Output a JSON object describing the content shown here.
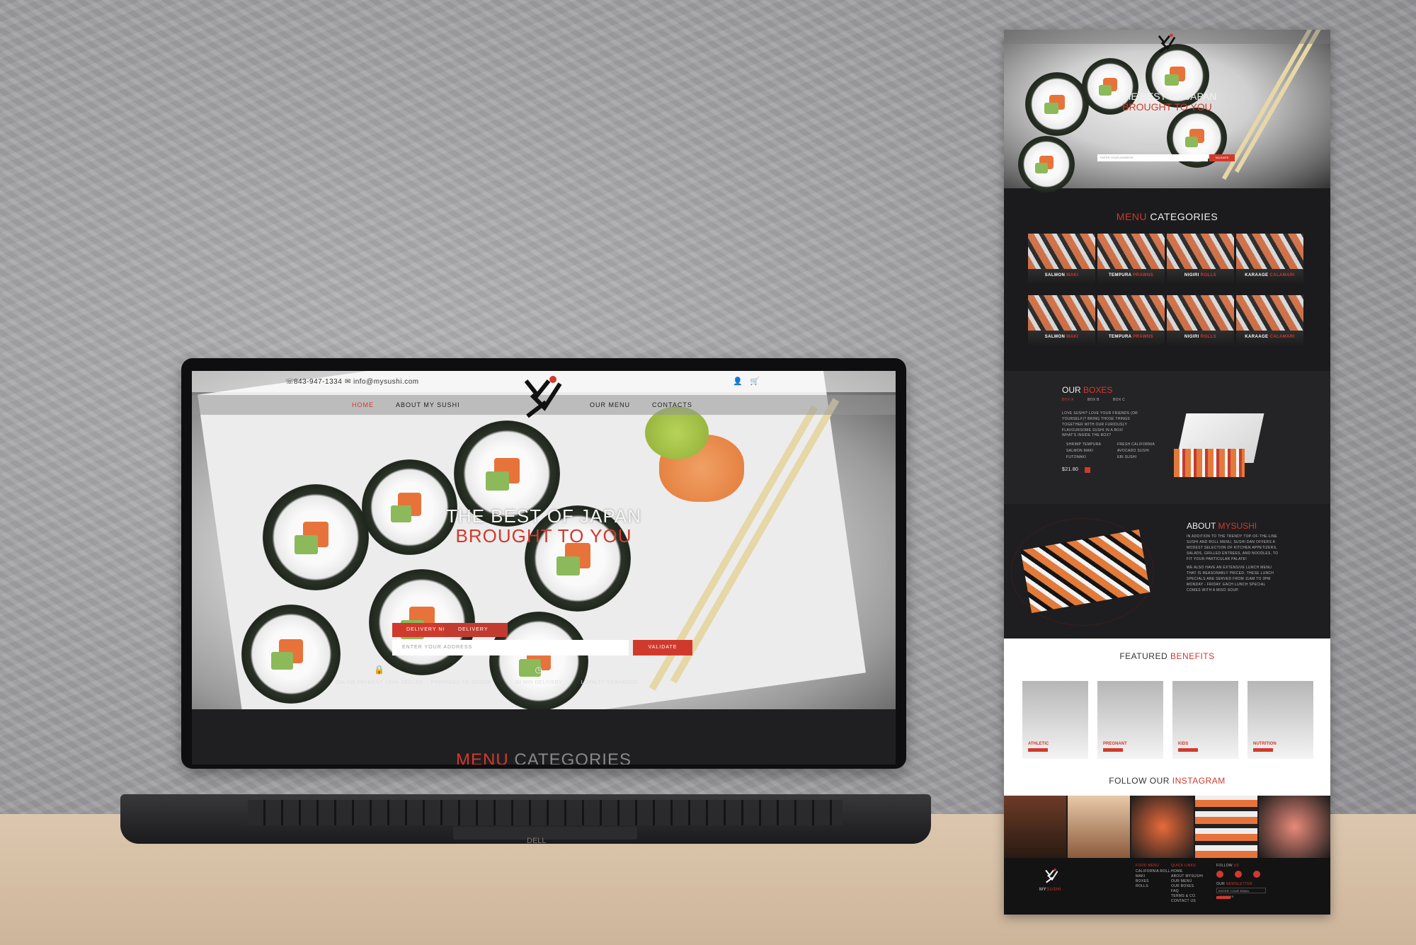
{
  "laptop": {
    "topbar": {
      "phone": "843-947-1334",
      "email": "info@mysushi.com"
    },
    "nav": [
      "HOME",
      "ABOUT MY SUSHI",
      "OUR MENU",
      "CONTACTS"
    ],
    "hero": {
      "line1": "THE BEST OF JAPAN",
      "line2": "BROUGHT TO YOU"
    },
    "delivery_tabs": [
      "DELIVERY NOW",
      "DELIVERY LATER"
    ],
    "address_placeholder": "ENTER YOUR ADDRESS",
    "validate_label": "VALIDATE",
    "features": [
      {
        "icon": "lock-icon",
        "label": "ONLINE PAYMENT 100% SECURE"
      },
      {
        "icon": "timer-icon",
        "label": "PREPARED TO ORDER"
      },
      {
        "icon": "clock-icon",
        "label": "30 MIN DELIVERY"
      },
      {
        "icon": "heart-icon",
        "label": "LOYALTY REWARDED"
      }
    ],
    "section_title": {
      "accent": "MENU",
      "rest": "CATEGORIES"
    },
    "brand": "DELL"
  },
  "tall": {
    "hero": {
      "line1": "THE BEST OF JAPAN",
      "line2": "BROUGHT TO YOU",
      "validate_label": "VALIDATE",
      "address_placeholder": "ENTER YOUR ADDRESS"
    },
    "menu_title": {
      "accent": "MENU",
      "rest": "CATEGORIES"
    },
    "categories": [
      {
        "name": "SALMON",
        "accent": "MAKI"
      },
      {
        "name": "TEMPURA",
        "accent": "PRAWNS"
      },
      {
        "name": "NIGIRI",
        "accent": "ROLLS"
      },
      {
        "name": "KARAAGE",
        "accent": "CALAMARI"
      },
      {
        "name": "SALMON",
        "accent": "MAKI"
      },
      {
        "name": "TEMPURA",
        "accent": "PRAWNS"
      },
      {
        "name": "NIGIRI",
        "accent": "ROLLS"
      },
      {
        "name": "KARAAGE",
        "accent": "CALAMARI"
      }
    ],
    "boxes": {
      "title": "OUR",
      "title_accent": "BOXES",
      "tabs": [
        "BOX A",
        "BOX B",
        "BOX C"
      ],
      "intro": "LOVE SUSHI? LOVE YOUR FRIENDS (OR YOURSELF)? BRING THOSE THINGS TOGETHER WITH OUR FURIOUSLY FLAVOURSOME SUSHI IN A BOX!",
      "inside_title": "WHAT'S INSIDE THE BOX?",
      "items_left": [
        "SHRIMP TEMPURA",
        "SALMON MAKI",
        "FUTOMAKI"
      ],
      "items_right": [
        "FRESH CALIFORNIA",
        "AVOCADO SUSHI",
        "EBI SUSHI"
      ],
      "price": "$21.80"
    },
    "about": {
      "title": "ABOUT",
      "title_accent": "MYSUSHI",
      "p1": "IN ADDITION TO THE TRENDY TOP-OF-THE-LINE SUSHI AND ROLL MENU, SUSHI DAN OFFERS A MODEST SELECTION OF KITCHEN APPETIZERS, SALADS, GRILLED ENTREES, AND NOODLES, TO FIT YOUR PARTICULAR PALATE!",
      "p2": "WE ALSO HAVE AN EXTENSIVE LUNCH MENU THAT IS REASONABLY PRICED. THESE LUNCH SPECIALS ARE SERVED FROM 11AM TO 3PM MONDAY - FRIDAY. EACH LUNCH SPECIAL COMES WITH A MISO SOUP."
    },
    "benefits_title": {
      "rest": "FEATURED",
      "accent": "BENEFITS"
    },
    "benefits": [
      "ATHLETIC",
      "PREGNANT",
      "KIDS",
      "NUTRITION"
    ],
    "instagram_title": {
      "rest": "FOLLOW OUR",
      "accent": "INSTAGRAM"
    },
    "footer": {
      "brand": "MY",
      "brand_accent": "SUSHI",
      "food_menu_title": "FOOD MENU",
      "food_menu": [
        "CALIFORNIA ROLL",
        "MAKI",
        "BOXES",
        "ROLLS"
      ],
      "quick_links_title": "QUICK LINKS",
      "quick_links": [
        "HOME",
        "ABOUT MYSUSHI",
        "OUR MENU",
        "OUR BOXES",
        "FAQ",
        "TERMS & CO.",
        "CONTACT US"
      ],
      "follow_title": "FOLLOW",
      "follow_accent": "US",
      "newsletter_title": "OUR",
      "newsletter_accent": "NEWSLETTER",
      "newsletter_placeholder": "ENTER YOUR EMAIL ADDRESS"
    }
  },
  "colors": {
    "accent": "#d03a2c",
    "dark": "#1b1b1d"
  }
}
